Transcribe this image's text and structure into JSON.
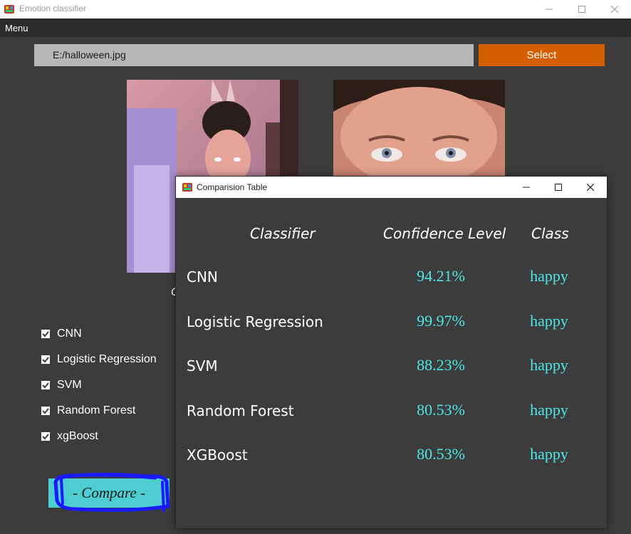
{
  "window": {
    "title": "Emotion classifier",
    "icon": "app-icon"
  },
  "menubar": {
    "items": [
      "Menu"
    ]
  },
  "file": {
    "path": "E:/halloween.jpg",
    "select_label": "Select"
  },
  "images": {
    "original": "halloween-photo",
    "face": "cropped-face-photo"
  },
  "caption_fragment": "C",
  "classifiers": [
    {
      "label": "CNN",
      "checked": true
    },
    {
      "label": "Logistic Regression",
      "checked": true
    },
    {
      "label": "SVM",
      "checked": true
    },
    {
      "label": "Random Forest",
      "checked": true
    },
    {
      "label": "xgBoost",
      "checked": true
    }
  ],
  "compare_label": "- Compare -",
  "dialog": {
    "title": "Comparision Table",
    "headers": {
      "classifier": "Classifier",
      "confidence": "Confidence Level",
      "class": "Class"
    },
    "rows": [
      {
        "classifier": "CNN",
        "confidence": "94.21%",
        "class": "happy"
      },
      {
        "classifier": "Logistic Regression",
        "confidence": "99.97%",
        "class": "happy"
      },
      {
        "classifier": "SVM",
        "confidence": "88.23%",
        "class": "happy"
      },
      {
        "classifier": "Random Forest",
        "confidence": "80.53%",
        "class": "happy"
      },
      {
        "classifier": "XGBoost",
        "confidence": "80.53%",
        "class": "happy"
      }
    ]
  },
  "colors": {
    "background": "#3c3c3c",
    "select": "#d35f00",
    "compare": "#4ecdd0",
    "result": "#4ee6e6",
    "scribble": "#1a1aff"
  }
}
